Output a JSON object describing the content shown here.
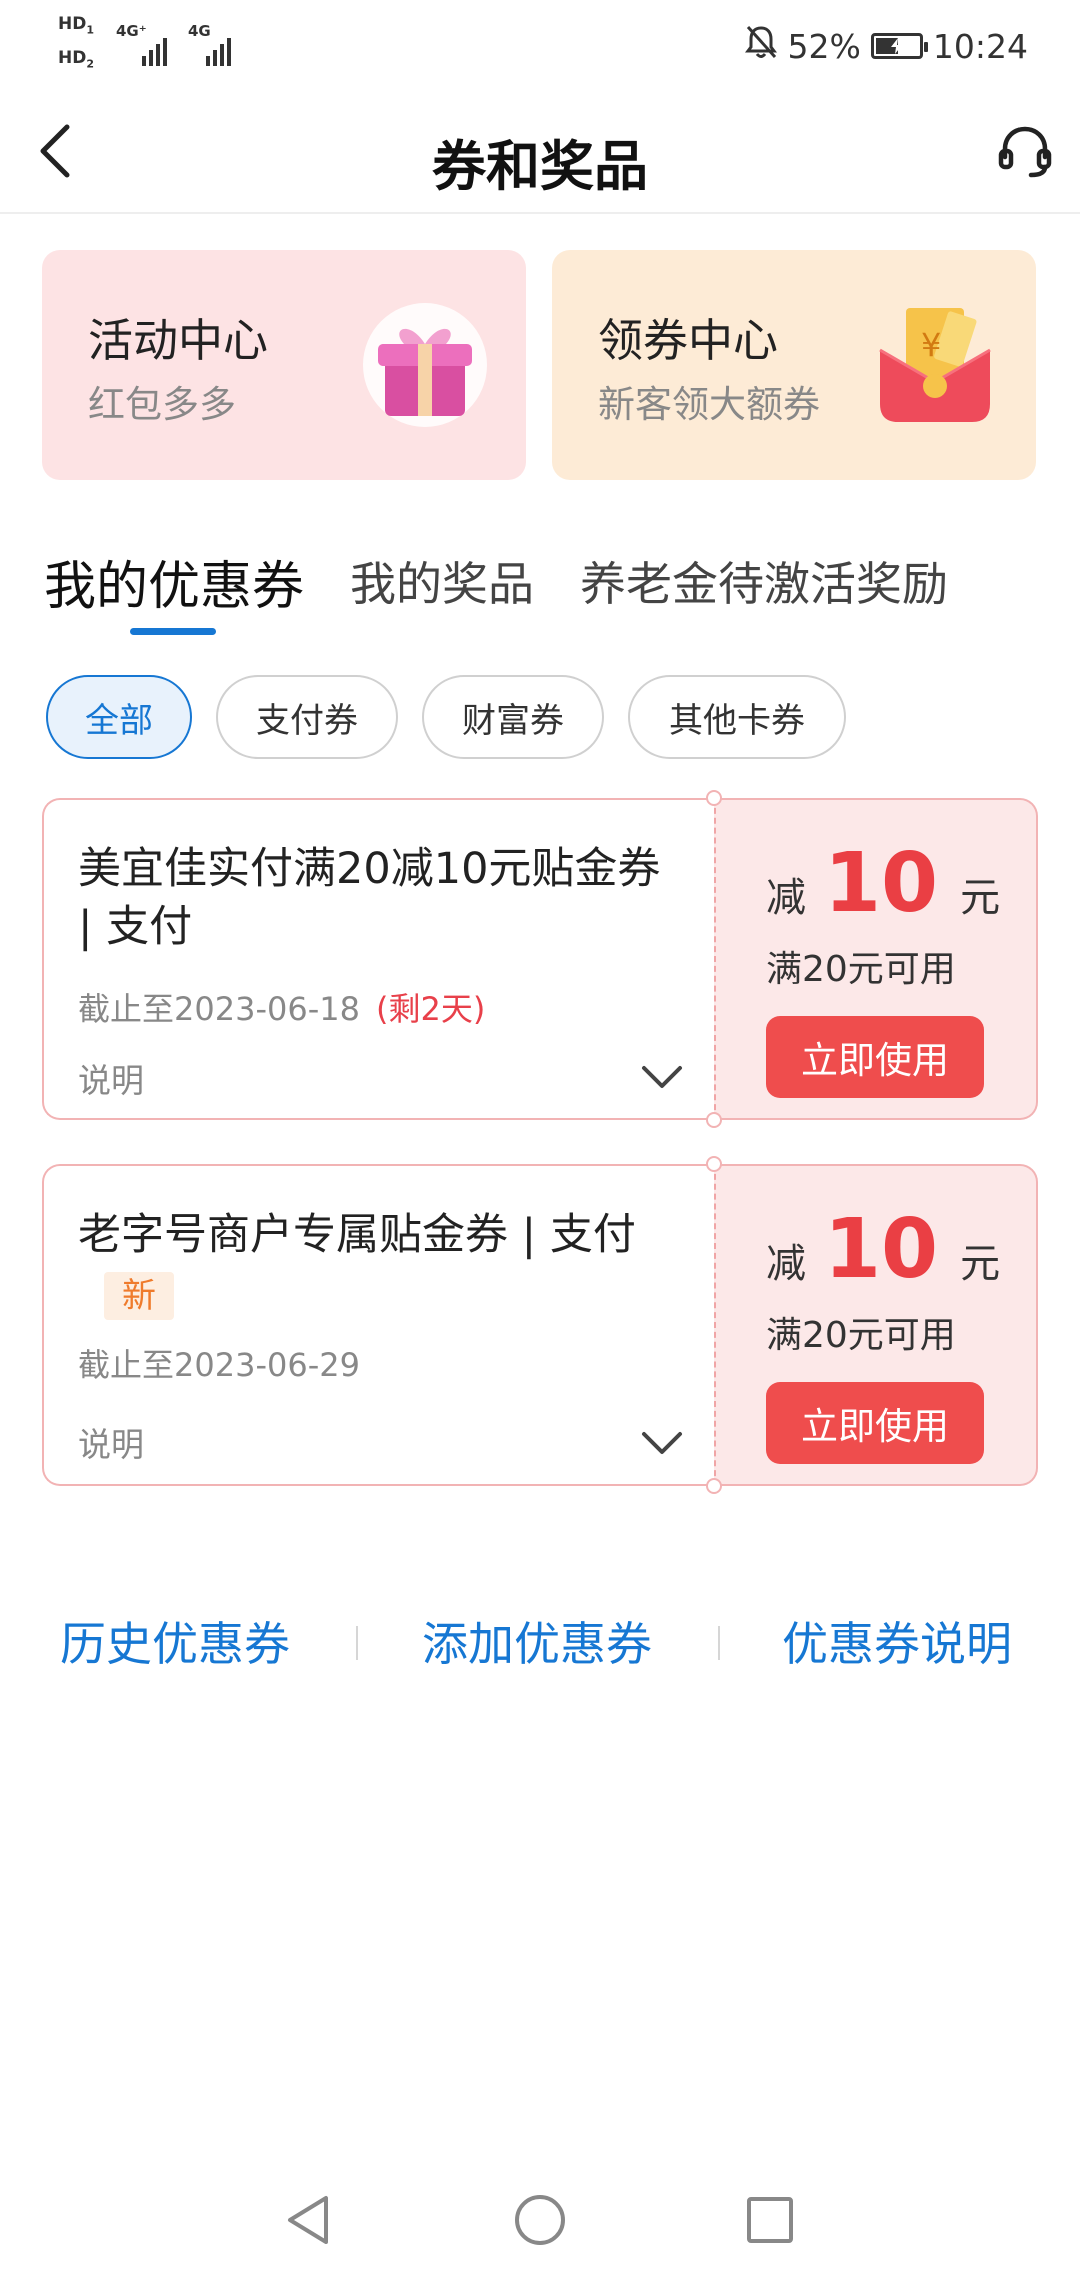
{
  "status_bar": {
    "sim1_label": "HD",
    "sim1_index": "1",
    "sim2_label": "HD",
    "sim2_index": "2",
    "net1": "4G⁺",
    "net2": "4G",
    "battery_percent": "52%",
    "battery_level": 0.52,
    "time": "10:24"
  },
  "header": {
    "title": "券和奖品"
  },
  "feature_cards": [
    {
      "title": "活动中心",
      "subtitle": "红包多多",
      "icon": "gift-box-icon"
    },
    {
      "title": "领券中心",
      "subtitle": "新客领大额券",
      "icon": "red-envelope-icon"
    }
  ],
  "tabs": [
    {
      "label": "我的优惠券",
      "active": true
    },
    {
      "label": "我的奖品",
      "active": false
    },
    {
      "label": "养老金待激活奖励",
      "active": false
    }
  ],
  "filters": [
    {
      "label": "全部",
      "active": true
    },
    {
      "label": "支付券",
      "active": false
    },
    {
      "label": "财富券",
      "active": false
    },
    {
      "label": "其他卡券",
      "active": false
    }
  ],
  "coupons": [
    {
      "title": "美宜佳实付满20减10元贴金券 | 支付",
      "badge": "",
      "expiry": "截止至2023-06-18",
      "remaining": "(剩2天)",
      "desc_label": "说明",
      "prefix": "减",
      "amount": "10",
      "unit": "元",
      "condition": "满20元可用",
      "button": "立即使用"
    },
    {
      "title": "老字号商户专属贴金券 | 支付",
      "badge": "新",
      "expiry": "截止至2023-06-29",
      "remaining": "",
      "desc_label": "说明",
      "prefix": "减",
      "amount": "10",
      "unit": "元",
      "condition": "满20元可用",
      "button": "立即使用"
    }
  ],
  "bottom_links": [
    {
      "label": "历史优惠券"
    },
    {
      "label": "添加优惠券"
    },
    {
      "label": "优惠券说明"
    }
  ],
  "colors": {
    "accent_blue": "#1677d3",
    "coupon_red": "#ea3f44",
    "button_red": "#ef4d4d",
    "activity_card_bg": "#fde3e4",
    "coupon_card_bg": "#fdebd6"
  }
}
